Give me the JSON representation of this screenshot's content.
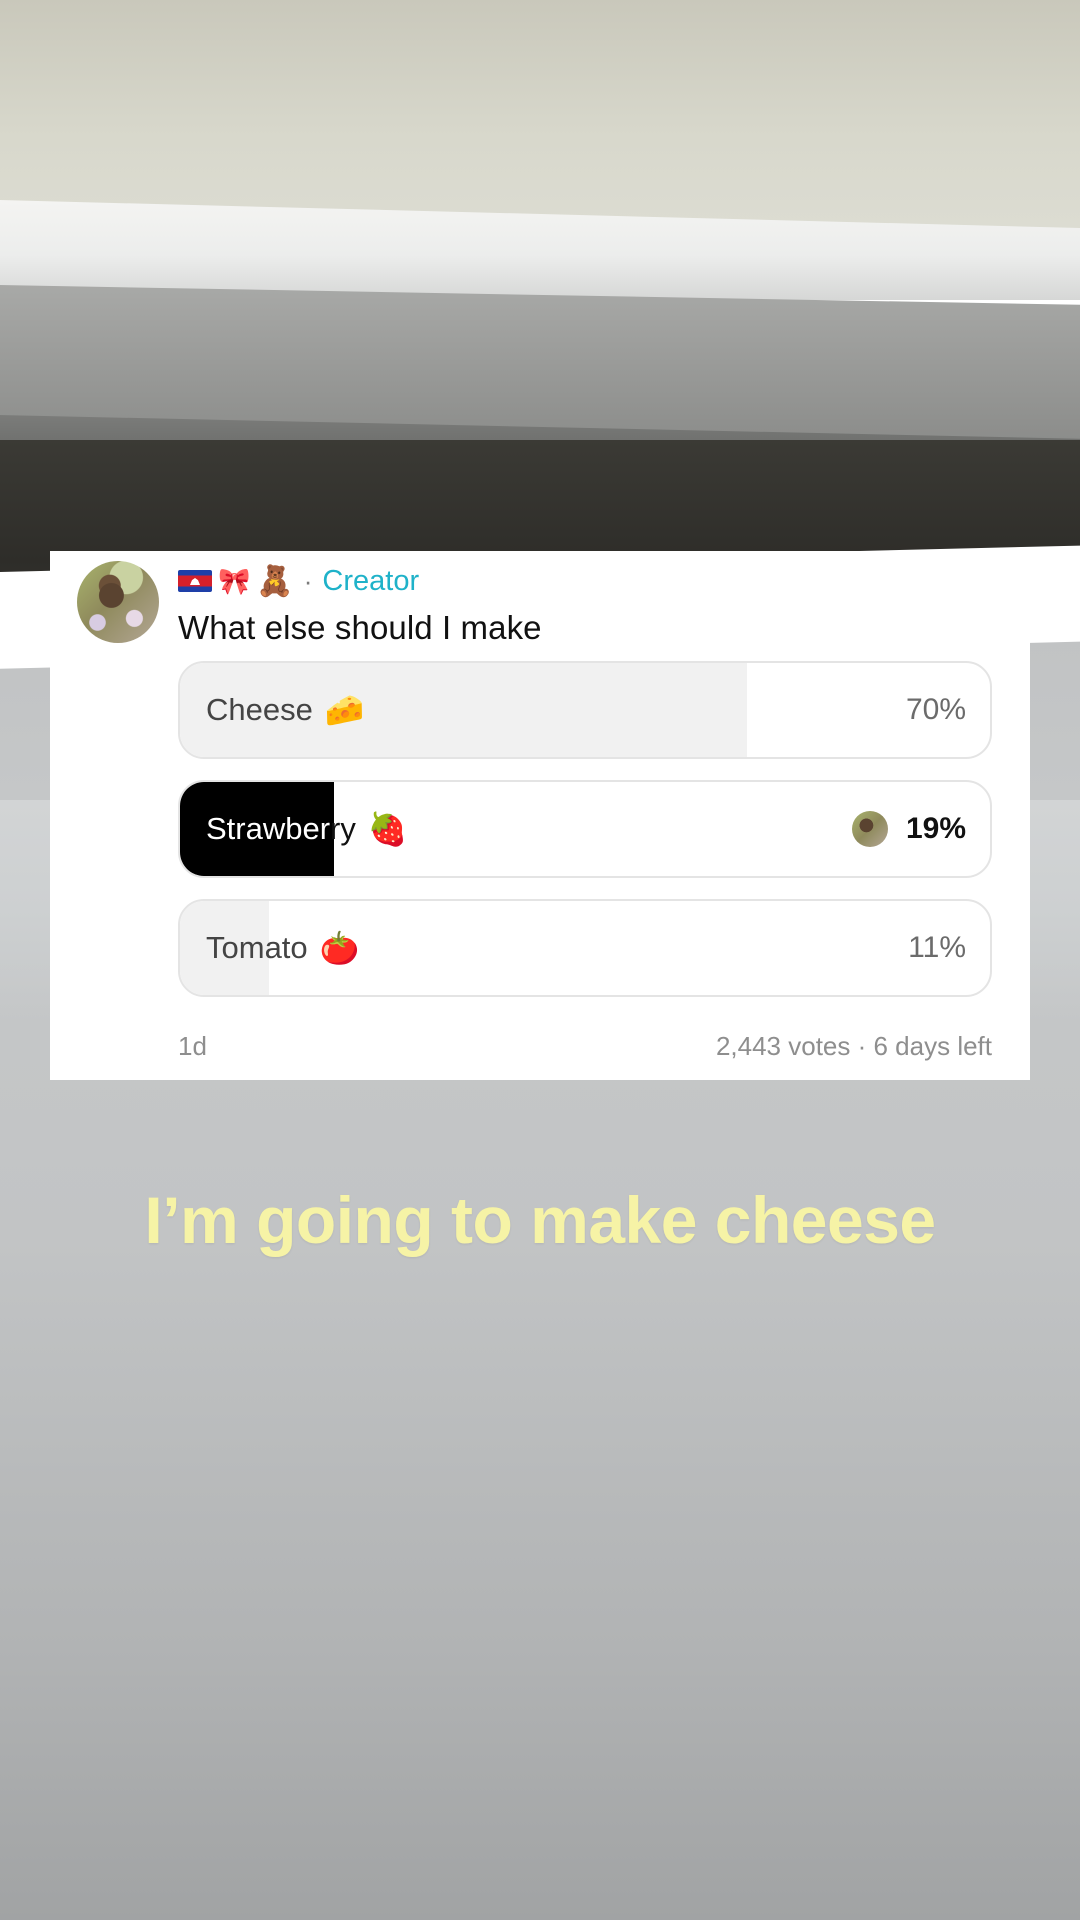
{
  "poll": {
    "author_emojis": {
      "bow": "🎀",
      "bear": "🧸"
    },
    "separator": "·",
    "creator_label": "Creator",
    "question": "What else should I make",
    "options": [
      {
        "label": "Cheese",
        "emoji": "🧀",
        "percent_text": "70%",
        "percent": 70,
        "selected": false
      },
      {
        "label": "Strawberry",
        "emoji": "🍓",
        "percent_text": "19%",
        "percent": 19,
        "selected": true
      },
      {
        "label": "Tomato",
        "emoji": "🍅",
        "percent_text": "11%",
        "percent": 11,
        "selected": false
      }
    ],
    "age": "1d",
    "votes_summary": "2,443 votes · 6 days left"
  },
  "caption": "I’m going to make cheese",
  "colors": {
    "creator": "#1fb2c9",
    "caption": "#f6f3a6",
    "selected_fill": "#000000",
    "option_fill": "#f1f1f1"
  }
}
